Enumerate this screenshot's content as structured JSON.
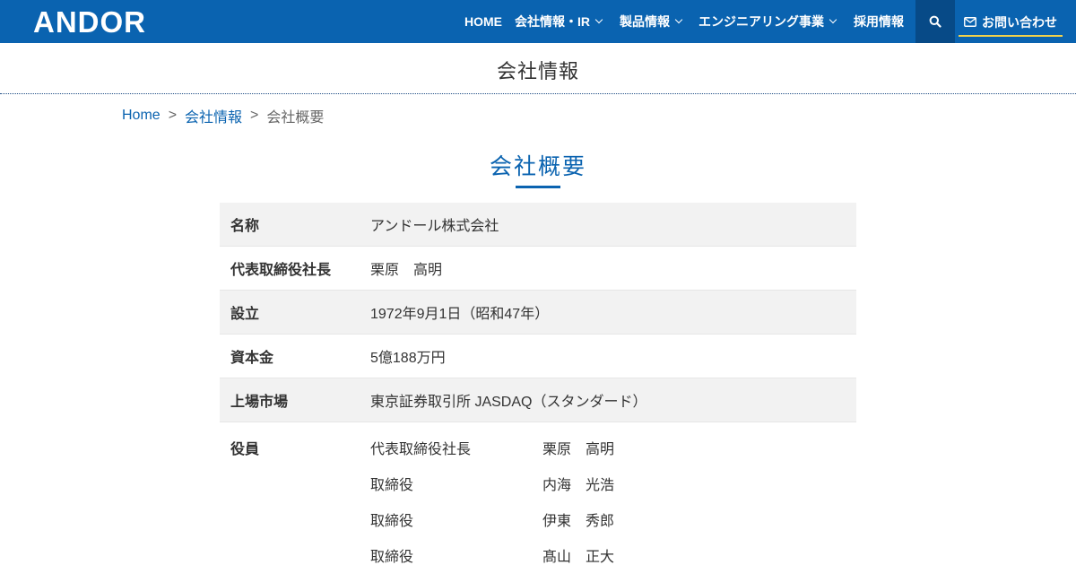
{
  "header": {
    "logo_text": "ANDOR",
    "nav": [
      {
        "label": "HOME",
        "has_dropdown": false
      },
      {
        "label": "会社情報・IR",
        "has_dropdown": true
      },
      {
        "label": "製品情報",
        "has_dropdown": true
      },
      {
        "label": "エンジニアリング事業",
        "has_dropdown": true
      },
      {
        "label": "採用情報",
        "has_dropdown": false
      }
    ],
    "search_icon": "search-icon",
    "contact_icon": "mail-icon",
    "contact_label": "お問い合わせ",
    "colors": {
      "bar": "#0a63b0",
      "search_bg": "#074a87",
      "contact_underline": "#f2d24b"
    }
  },
  "page_title": "会社情報",
  "breadcrumb": {
    "home": "Home",
    "separator": ">",
    "parent": "会社情報",
    "current": "会社概要"
  },
  "section_title": "会社概要",
  "table": {
    "rows": [
      {
        "label": "名称",
        "value": "アンドール株式会社"
      },
      {
        "label": "代表取締役社長",
        "value": "栗原　高明"
      },
      {
        "label": "設立",
        "value": "1972年9月1日（昭和47年）"
      },
      {
        "label": "資本金",
        "value": "5億188万円"
      },
      {
        "label": "上場市場",
        "value": "東京証券取引所 JASDAQ（スタンダード）"
      }
    ],
    "officers_label": "役員",
    "officers": [
      {
        "role": "代表取締役社長",
        "name": "栗原　高明"
      },
      {
        "role": "取締役",
        "name": "内海　光浩"
      },
      {
        "role": "取締役",
        "name": "伊東　秀郎"
      },
      {
        "role": "取締役",
        "name": "髙山　正大"
      }
    ]
  }
}
